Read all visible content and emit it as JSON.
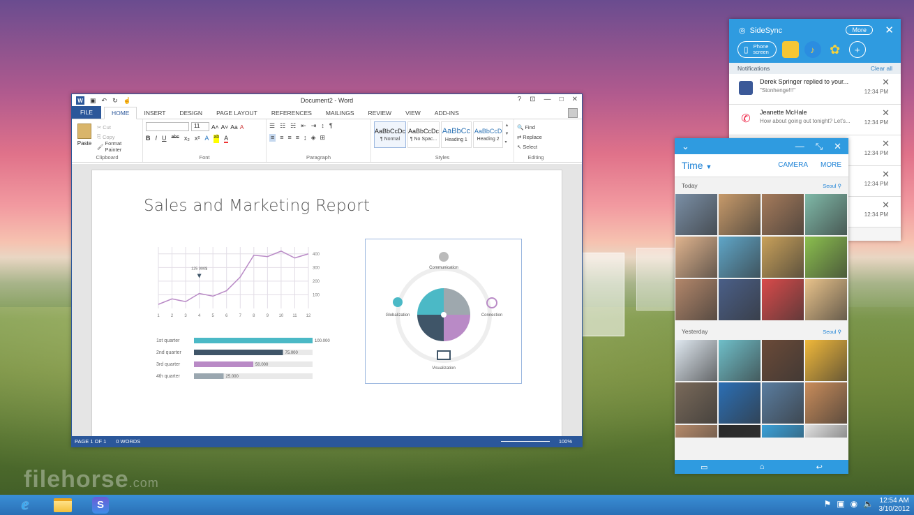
{
  "watermark": {
    "brand": "filehorse",
    "domain": ".com"
  },
  "taskbar": {
    "ie_glyph": "e",
    "sidesync_glyph": "S",
    "clock_time": "12:54 AM",
    "clock_date": "3/10/2012"
  },
  "word": {
    "doc_title": "Document2 - Word",
    "icon_letter": "W",
    "title_controls": {
      "help": "?",
      "ribbon_opts": "⊡",
      "minimize": "—",
      "maximize": "□",
      "close": "✕"
    },
    "tabs": [
      "FILE",
      "HOME",
      "INSERT",
      "DESIGN",
      "PAGE LAYOUT",
      "REFERENCES",
      "MAILINGS",
      "REVIEW",
      "VIEW",
      "ADD-INS"
    ],
    "ribbon": {
      "clipboard": {
        "paste": "Paste",
        "cut": "Cut",
        "copy": "Copy",
        "format_painter": "Format Painter",
        "label": "Clipboard"
      },
      "font": {
        "font_name": "",
        "font_size": "11",
        "grow": "A˄",
        "shrink": "A˅",
        "case": "Aa",
        "clear": "A",
        "bold": "B",
        "italic": "I",
        "underline": "U",
        "strike": "abc",
        "sub": "x₂",
        "sup": "x²",
        "effects": "A",
        "highlight": "ab",
        "color": "A",
        "label": "Font"
      },
      "paragraph": {
        "label": "Paragraph"
      },
      "styles": {
        "items": [
          {
            "preview": "AaBbCcDc",
            "name": "¶ Normal"
          },
          {
            "preview": "AaBbCcDc",
            "name": "¶ No Spac..."
          },
          {
            "preview": "AaBbCc",
            "name": "Heading 1"
          },
          {
            "preview": "AaBbCcD",
            "name": "Heading 2"
          }
        ],
        "label": "Styles"
      },
      "editing": {
        "find": "Find",
        "replace": "Replace",
        "select": "Select",
        "label": "Editing"
      }
    },
    "status": {
      "page": "PAGE 1 OF 1",
      "words": "0 WORDS",
      "zoom": "100%"
    }
  },
  "report": {
    "title": "Sales and Marketing Report",
    "line_callout": "125 000$",
    "wheel_labels": {
      "top": "Communication",
      "left": "Globalization",
      "right": "Connection",
      "bottom": "Visualization"
    }
  },
  "chart_data": [
    {
      "type": "line",
      "x": [
        1,
        2,
        3,
        4,
        5,
        6,
        7,
        8,
        9,
        10,
        11,
        12
      ],
      "y": [
        30,
        70,
        50,
        110,
        90,
        130,
        230,
        390,
        380,
        420,
        370,
        400
      ],
      "xlabel": "",
      "ylabel": "",
      "ylim": [
        0,
        450
      ],
      "yticks": [
        100,
        200,
        300,
        400
      ],
      "grid": true,
      "annotations": [
        {
          "x": 4,
          "text": "125 000$"
        }
      ]
    },
    {
      "type": "bar",
      "orientation": "horizontal",
      "categories": [
        "1st quarter",
        "2nd quarter",
        "3rd quarter",
        "4th quarter"
      ],
      "values": [
        100000,
        75000,
        50000,
        25000
      ],
      "data_labels": [
        "100.000",
        "75.000",
        "50.000",
        "25.000"
      ],
      "colors": [
        "#4bb9c6",
        "#3f5568",
        "#b98ac6",
        "#9aa7b0"
      ],
      "xlim": [
        0,
        100000
      ]
    }
  ],
  "sidesync": {
    "title": "SideSync",
    "more": "More",
    "close": "✕",
    "phone_screen": "Phone screen",
    "notifications_label": "Notifications",
    "clear_all": "Clear all",
    "notifications": [
      {
        "icon": "facebook-icon",
        "title": "Derek Springer replied to your...",
        "sub": "\"Stonhenge!!!\"",
        "time": "12:34 PM"
      },
      {
        "icon": "missed-call-icon",
        "title": "Jeanette McHale",
        "sub": "How about going out tonight? Let's...",
        "time": "12:34 PM"
      },
      {
        "icon": "",
        "title": "",
        "sub": "",
        "time": "12:34 PM"
      },
      {
        "icon": "",
        "title": "",
        "sub": "",
        "time": "12:34 PM"
      },
      {
        "icon": "",
        "title": "",
        "sub": "",
        "time": "12:34 PM"
      }
    ]
  },
  "gallery": {
    "view": "Time",
    "camera": "CAMERA",
    "more": "MORE",
    "sections": [
      {
        "label": "Today",
        "location": "Seoul"
      },
      {
        "label": "Yesterday",
        "location": "Seoul"
      }
    ],
    "thumb_colors_today": [
      "#7a8fa6",
      "#c79a6a",
      "#a67b5b",
      "#7fb9a8",
      "#e0b48e",
      "#5fa6c8",
      "#c9a15a",
      "#8bbf4e",
      "#b3876a",
      "#4a5f88",
      "#d94a4a",
      "#e8c28a"
    ],
    "thumb_colors_yesterday": [
      "#dfe8f0",
      "#6fbfc9",
      "#6b4a38",
      "#f0b83a",
      "#7a6a5a",
      "#2b6fb5",
      "#5a7da0",
      "#c98c5a",
      "#b58a6a",
      "#2a2a2a",
      "#3aa0d8",
      "#e0e0e0"
    ]
  },
  "colors": {
    "word_blue": "#2b579a",
    "sidesync_blue": "#2f9be0",
    "accent_teal": "#4bb9c6"
  }
}
